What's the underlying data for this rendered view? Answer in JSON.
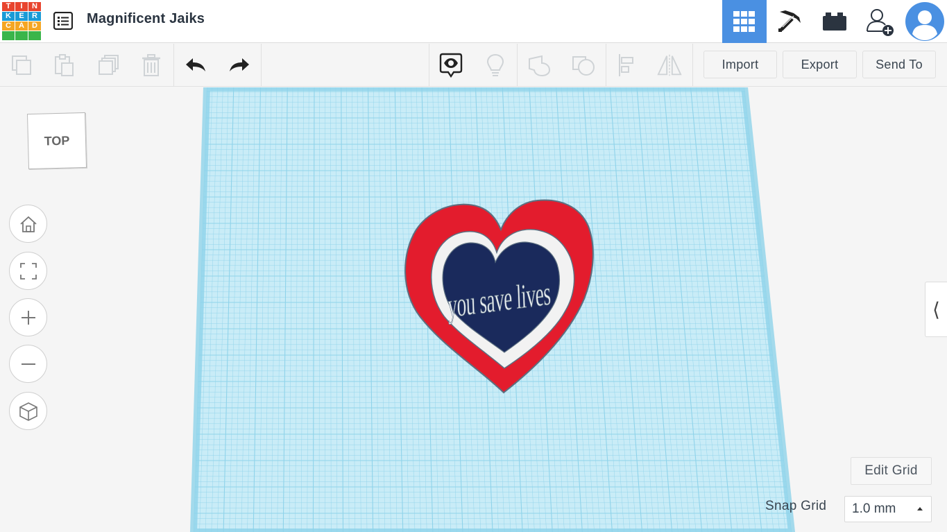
{
  "app": {
    "logo_letters": [
      "T",
      "I",
      "N",
      "K",
      "E",
      "R",
      "C",
      "A",
      "D"
    ],
    "logo_colors": [
      "#e8442e",
      "#e8442e",
      "#e8442e",
      "#1a9bd7",
      "#1a9bd7",
      "#1a9bd7",
      "#f5a623",
      "#f5a623",
      "#f5a623",
      "#3ab54a",
      "#3ab54a",
      "#3ab54a"
    ],
    "design_title": "Magnificent Jaiks"
  },
  "header": {
    "active_color": "#4a90e2",
    "buttons": [
      {
        "name": "grid-view-icon",
        "active": true
      },
      {
        "name": "pickaxe-icon",
        "active": false
      },
      {
        "name": "bricks-icon",
        "active": false
      },
      {
        "name": "add-user-icon",
        "active": false
      },
      {
        "name": "avatar-icon",
        "active": false
      }
    ]
  },
  "toolbar": {
    "import_label": "Import",
    "export_label": "Export",
    "send_to_label": "Send To"
  },
  "viewcube": {
    "face_label": "TOP"
  },
  "workplane": {
    "grid_color": "#8fd3ea",
    "plane_color": "#c9ecf7",
    "model_text": "you save lives",
    "heart_outer_color": "#e31c2d",
    "heart_middle_color": "#f2f2f2",
    "heart_inner_color": "#1a2a5c"
  },
  "grid_controls": {
    "edit_grid_label": "Edit Grid",
    "snap_grid_label": "Snap Grid",
    "snap_grid_value": "1.0 mm"
  }
}
